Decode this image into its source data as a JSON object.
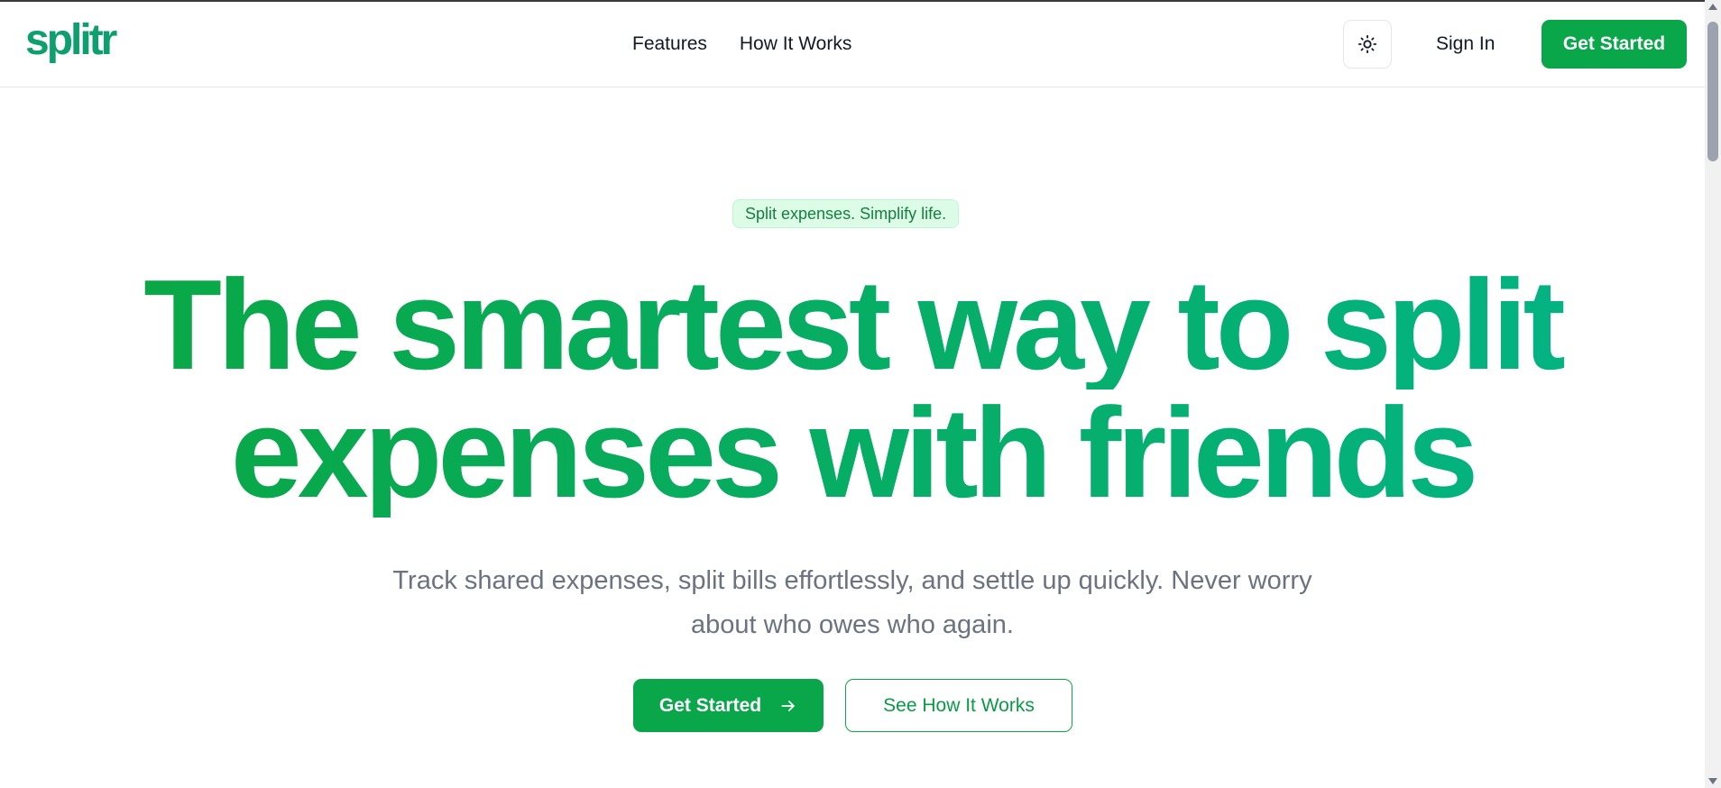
{
  "brand": {
    "logo_text": "splitr",
    "logo_color": "#0e9f6e"
  },
  "nav": {
    "links": [
      {
        "label": "Features"
      },
      {
        "label": "How It Works"
      }
    ],
    "theme_icon": "sun-icon",
    "sign_in_label": "Sign In",
    "get_started_label": "Get Started"
  },
  "hero": {
    "badge": "Split expenses. Simplify life.",
    "headline_line1": "The smartest way to split",
    "headline_line2": "expenses with friends",
    "subtitle": "Track shared expenses, split bills effortlessly, and settle up quickly. Never worry about who owes who again.",
    "primary_cta": "Get Started",
    "primary_cta_icon": "arrow-right-icon",
    "secondary_cta": "See How It Works"
  },
  "colors": {
    "accent": "#0aa64a",
    "gradient_start": "#0aa640",
    "gradient_end": "#03b488",
    "badge_bg": "#dcfce7",
    "muted_text": "#6b7280"
  }
}
